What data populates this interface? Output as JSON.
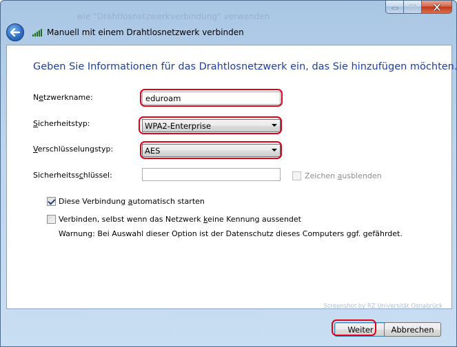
{
  "window": {
    "title": "Manuell mit einem Drahtlosnetzwerk verbinden",
    "ghost_title": "wie \"Drahtlosnetzwerkverbindung\" verwenden"
  },
  "caption": {
    "minimize_icon": "minimize-icon",
    "maximize_icon": "maximize-icon",
    "close_icon": "close-icon"
  },
  "heading": "Geben Sie Informationen für das Drahtlosnetzwerk ein, das Sie hinzufügen möchten.",
  "fields": {
    "network_name": {
      "label_pre": "N",
      "label_acc": "e",
      "label_post": "tzwerkname:",
      "value": "eduroam"
    },
    "security_type": {
      "label_pre": "",
      "label_acc": "S",
      "label_post": "icherheitstyp:",
      "value": "WPA2-Enterprise"
    },
    "encryption_type": {
      "label_pre": "",
      "label_acc": "V",
      "label_post": "erschlüsselungstyp:",
      "value": "AES"
    },
    "security_key": {
      "label_pre": "Sicherheitss",
      "label_acc": "c",
      "label_post": "hlüssel:",
      "value": ""
    }
  },
  "hide_chars": {
    "label_pre": "Zeichen ",
    "label_acc": "a",
    "label_post": "usblenden",
    "checked": false,
    "enabled": false
  },
  "auto_start": {
    "label_pre": "Diese Verbindung ",
    "label_acc": "a",
    "label_post": "utomatisch starten",
    "checked": true
  },
  "connect_hidden": {
    "label_pre": "Verbinden, selbst wenn das Netzwerk ",
    "label_acc": "k",
    "label_post": "eine Kennung aussendet",
    "checked": false
  },
  "warning": "Warnung: Bei Auswahl dieser Option ist der Datenschutz dieses Computers ggf. gefährdet.",
  "watermark": "Screenshot by RZ Universität Osnabrück",
  "buttons": {
    "next": "Weiter",
    "cancel": "Abbrechen"
  },
  "colors": {
    "heading": "#1e3f9e",
    "highlight": "#e0001a",
    "title_glass": "#bcd5ee"
  }
}
